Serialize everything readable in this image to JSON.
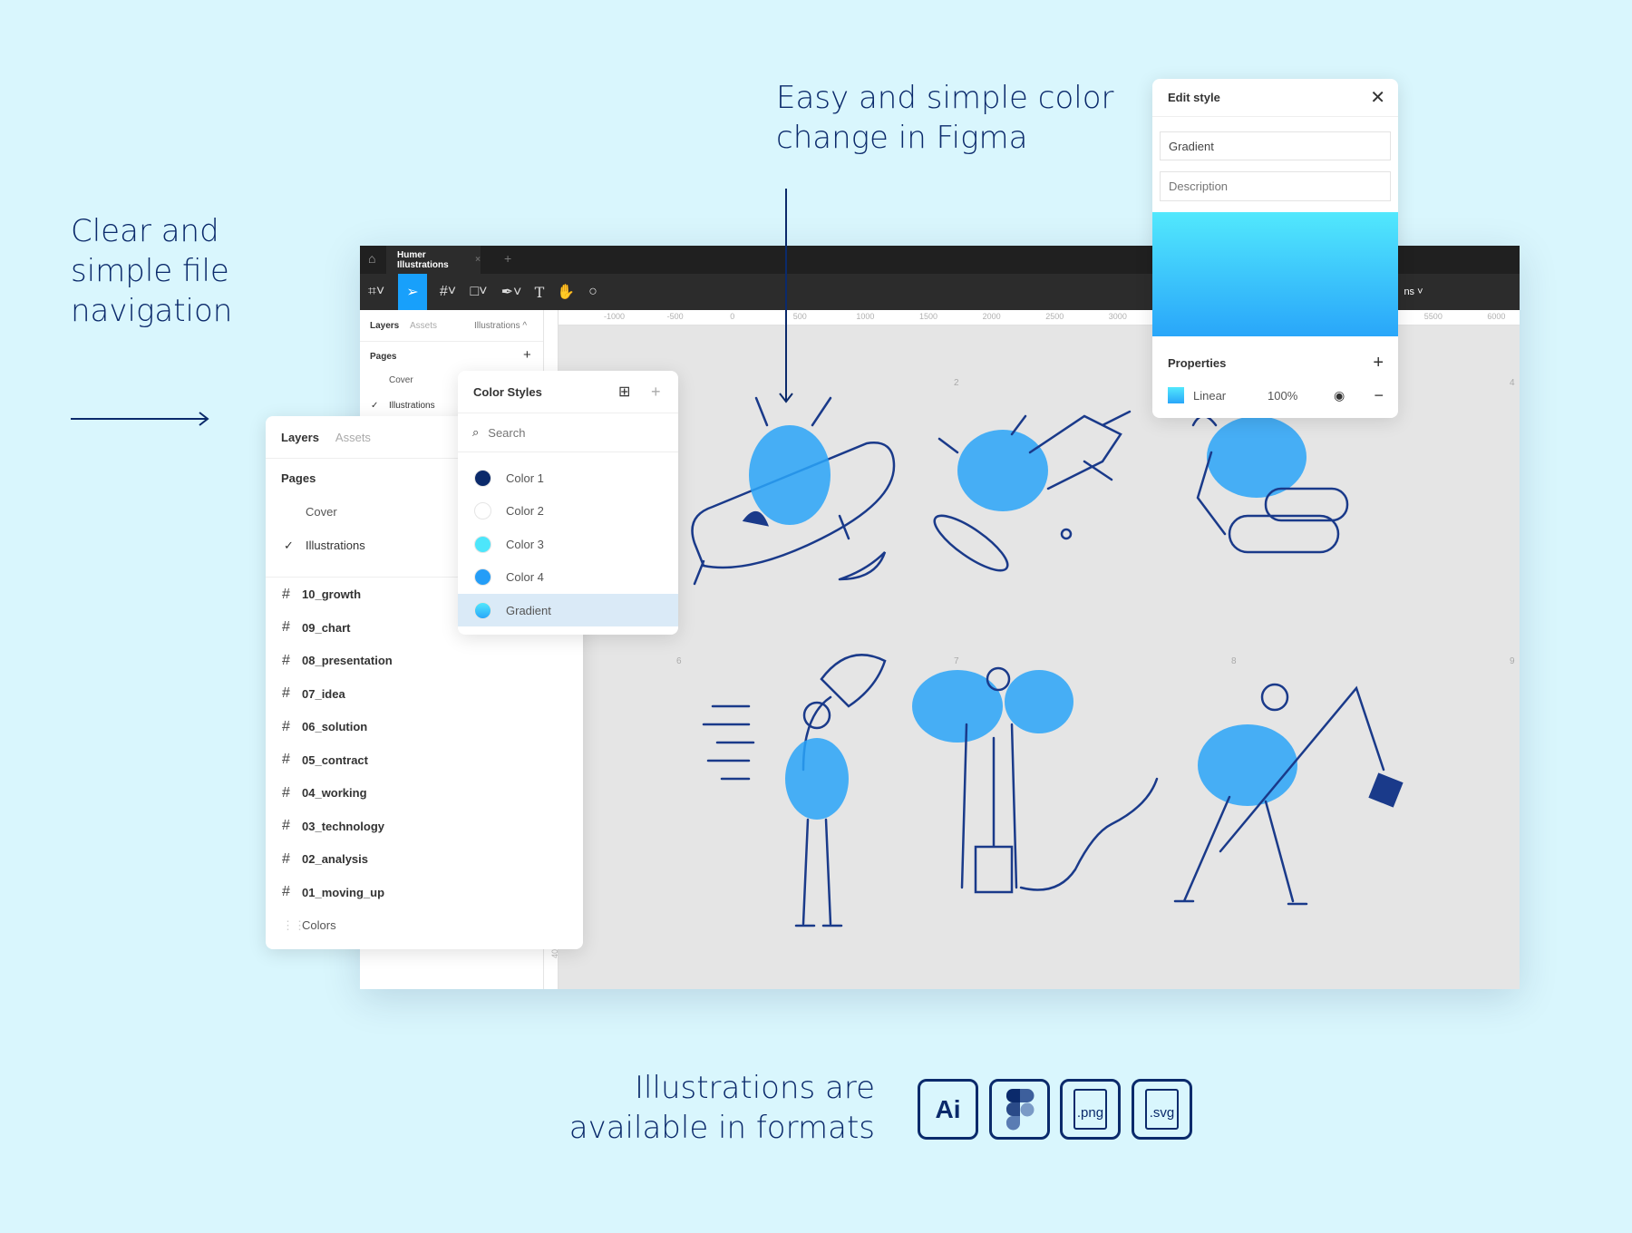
{
  "headlines": {
    "navigation": [
      "Clear and",
      "simple file",
      "navigation"
    ],
    "color": [
      "Easy and simple color",
      "change in Figma"
    ],
    "formats": [
      "Illustrations are",
      "available in formats"
    ]
  },
  "figma": {
    "tab_title": "Humer Illustrations",
    "toolbar_right": "ns",
    "ruler_labels": [
      "-1000",
      "-500",
      "0",
      "500",
      "1000",
      "1500",
      "2000",
      "2500",
      "3000",
      "5500",
      "6000"
    ],
    "vruler_label": "4000",
    "back_panel": {
      "tabs": [
        "Layers",
        "Assets"
      ],
      "page_select": "Illustrations ^",
      "pages_label": "Pages",
      "pages": [
        "Cover",
        "Illustrations"
      ]
    },
    "frame_numbers": [
      "2",
      "4",
      "6",
      "7",
      "8",
      "9"
    ]
  },
  "layers_panel": {
    "tabs": [
      "Layers",
      "Assets"
    ],
    "pages_label": "Pages",
    "pages": [
      {
        "label": "Cover",
        "current": false
      },
      {
        "label": "Illustrations",
        "current": true
      }
    ],
    "frames": [
      "10_growth",
      "09_chart",
      "08_presentation",
      "07_idea",
      "06_solution",
      "05_contract",
      "04_working",
      "03_technology",
      "02_analysis",
      "01_moving_up"
    ],
    "colors_label": "Colors"
  },
  "color_styles": {
    "title": "Color Styles",
    "search_placeholder": "Search",
    "items": [
      {
        "label": "Color 1",
        "color": "#0b2a6b"
      },
      {
        "label": "Color 2",
        "color": "#ffffff"
      },
      {
        "label": "Color 3",
        "color": "#4de6fb"
      },
      {
        "label": "Color 4",
        "color": "#249df7"
      },
      {
        "label": "Gradient",
        "color": "#35b8fb",
        "selected": true
      }
    ]
  },
  "edit_style": {
    "title": "Edit style",
    "name_value": "Gradient",
    "description_placeholder": "Description",
    "gradient_colors": [
      "#52e8fd",
      "#29a6f9"
    ],
    "properties_label": "Properties",
    "fill_type": "Linear",
    "opacity": "100%"
  },
  "formats": [
    "Ai",
    "Figma",
    ".png",
    ".svg"
  ]
}
